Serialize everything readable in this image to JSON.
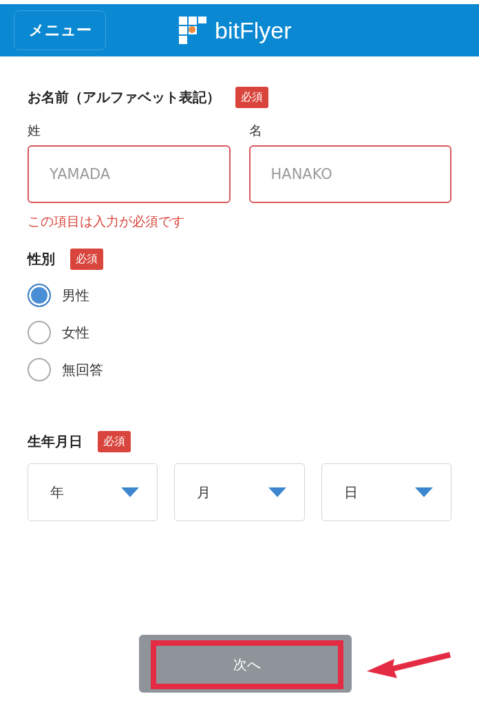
{
  "header": {
    "menu_button": "メニュー",
    "logo_text": "bitFlyer"
  },
  "name_section": {
    "title": "お名前（アルファベット表記）",
    "badge": "必須",
    "fields": [
      {
        "label": "姓",
        "placeholder": "YAMADA",
        "error": true
      },
      {
        "label": "名",
        "placeholder": "HANAKO",
        "error": true
      }
    ],
    "error_message": "この項目は入力が必須です"
  },
  "gender_section": {
    "title": "性別",
    "badge": "必須",
    "options": [
      {
        "label": "男性",
        "selected": true
      },
      {
        "label": "女性",
        "selected": false
      },
      {
        "label": "無回答",
        "selected": false
      }
    ]
  },
  "birthdate_section": {
    "title": "生年月日",
    "badge": "必須",
    "selects": [
      {
        "label": "年"
      },
      {
        "label": "月"
      },
      {
        "label": "日"
      }
    ]
  },
  "next_button": {
    "label": "次へ",
    "highlighted": true
  }
}
